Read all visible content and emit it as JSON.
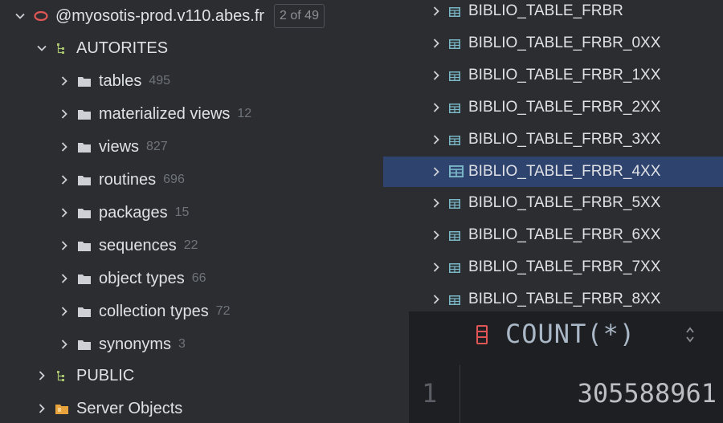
{
  "left_tree": {
    "connection": {
      "label": "@myosotis-prod.v110.abes.fr",
      "pager": "2 of 49"
    },
    "schema": {
      "label": "AUTORITES"
    },
    "folders": [
      {
        "label": "tables",
        "count": "495"
      },
      {
        "label": "materialized views",
        "count": "12"
      },
      {
        "label": "views",
        "count": "827"
      },
      {
        "label": "routines",
        "count": "696"
      },
      {
        "label": "packages",
        "count": "15"
      },
      {
        "label": "sequences",
        "count": "22"
      },
      {
        "label": "object types",
        "count": "66"
      },
      {
        "label": "collection types",
        "count": "72"
      },
      {
        "label": "synonyms",
        "count": "3"
      }
    ],
    "public_schema": {
      "label": "PUBLIC"
    },
    "server_objects": {
      "label": "Server Objects"
    }
  },
  "right_tree": {
    "tables": [
      {
        "label": "BIBLIO_TABLE_FRBR"
      },
      {
        "label": "BIBLIO_TABLE_FRBR_0XX"
      },
      {
        "label": "BIBLIO_TABLE_FRBR_1XX"
      },
      {
        "label": "BIBLIO_TABLE_FRBR_2XX"
      },
      {
        "label": "BIBLIO_TABLE_FRBR_3XX"
      },
      {
        "label": "BIBLIO_TABLE_FRBR_4XX"
      },
      {
        "label": "BIBLIO_TABLE_FRBR_5XX"
      },
      {
        "label": "BIBLIO_TABLE_FRBR_6XX"
      },
      {
        "label": "BIBLIO_TABLE_FRBR_7XX"
      },
      {
        "label": "BIBLIO_TABLE_FRBR_8XX"
      }
    ],
    "selected_index": 5
  },
  "result": {
    "column_header": "COUNT(*)",
    "row_number": "1",
    "value": "305588961"
  },
  "icons": {
    "connection": "oracle-db-icon",
    "schema": "schema-icon",
    "folder": "folder-icon",
    "table": "table-icon",
    "server_objects": "server-objects-icon",
    "column": "column-icon",
    "sort": "sort-icon"
  },
  "colors": {
    "selection": "#2e436e",
    "oracle_red": "#e05555",
    "table_icon": "#7ab8c8",
    "schema_icon": "#a8c46f",
    "server_objects_icon": "#e8a33d"
  }
}
